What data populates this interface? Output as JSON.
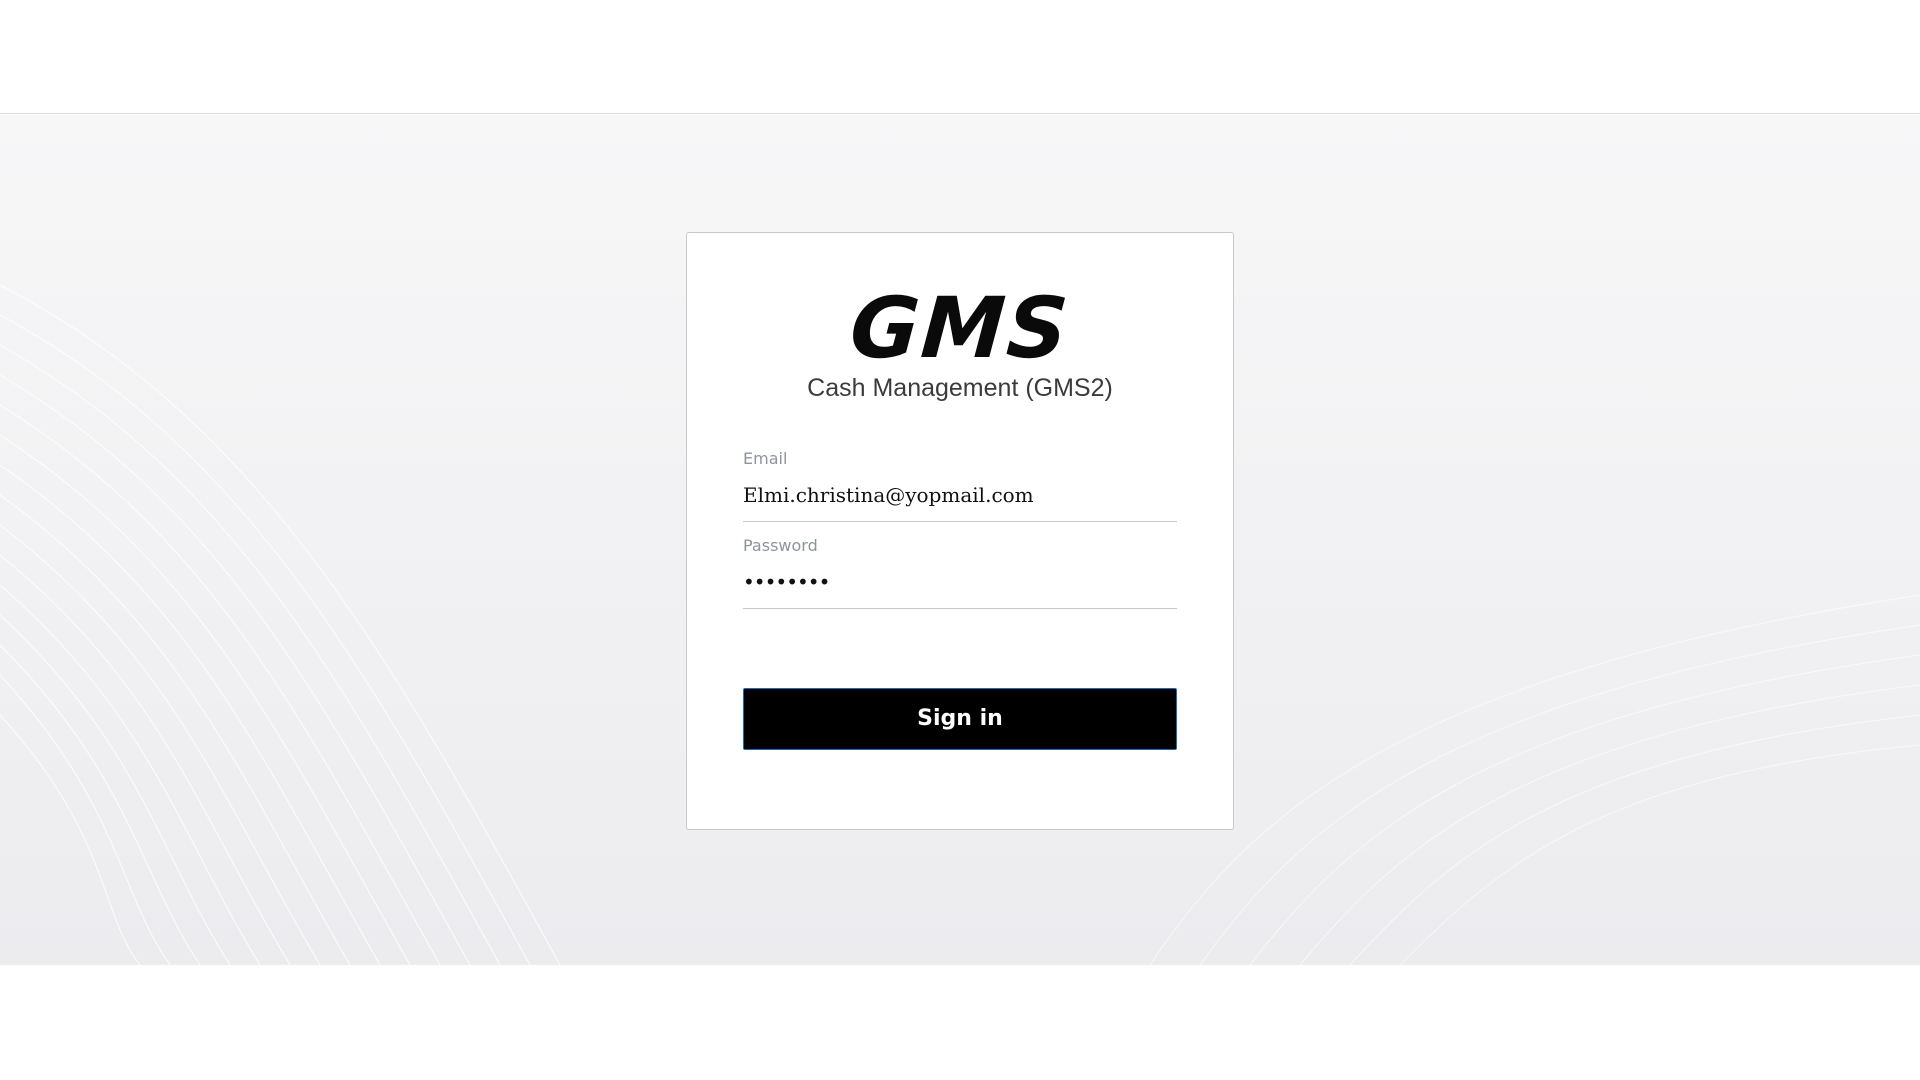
{
  "brand": {
    "logo_text": "GMS",
    "app_name": "Cash Management (GMS2)"
  },
  "login_form": {
    "email": {
      "label": "Email",
      "value": "Elmi.christina@yopmail.com"
    },
    "password": {
      "label": "Password",
      "masked_value": "••••••••"
    },
    "submit_label": "Sign in"
  },
  "colors": {
    "button_background": "#000000",
    "button_border": "#1b6bb8",
    "label_text": "#8e949b"
  }
}
